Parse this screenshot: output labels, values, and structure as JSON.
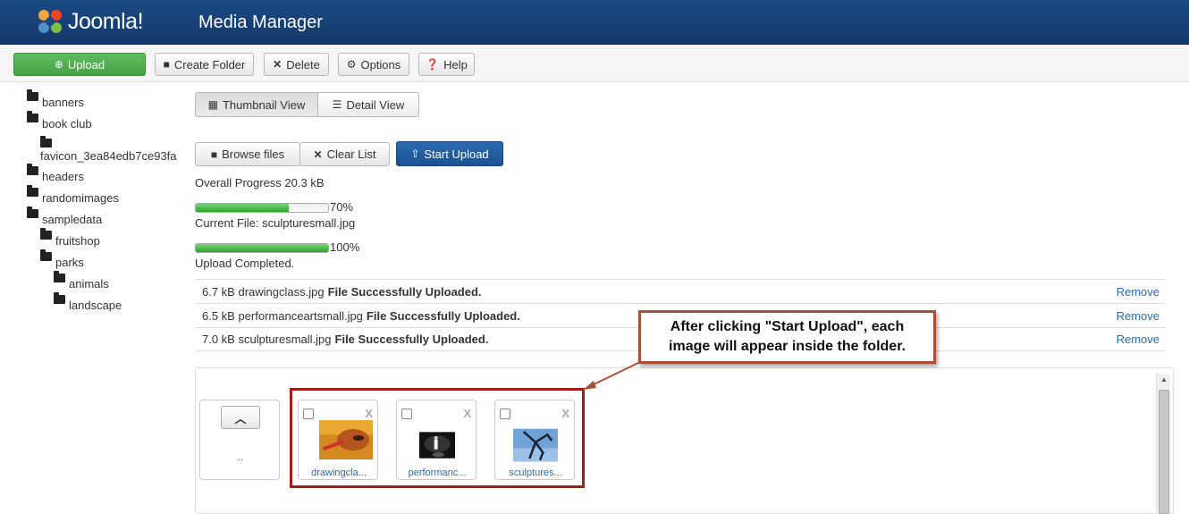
{
  "header": {
    "logo_text": "Joomla!",
    "title": "Media Manager",
    "brand_color": "#14396a"
  },
  "toolbar": {
    "upload": "Upload",
    "create_folder": "Create Folder",
    "delete": "Delete",
    "options": "Options",
    "help": "Help"
  },
  "tree": [
    {
      "label": "banners",
      "depth": 0
    },
    {
      "label": "book club",
      "depth": 0
    },
    {
      "label": "favicon_3ea84edb7ce93fa",
      "depth": 1
    },
    {
      "label": "headers",
      "depth": 0
    },
    {
      "label": "randomimages",
      "depth": 0
    },
    {
      "label": "sampledata",
      "depth": 0
    },
    {
      "label": "fruitshop",
      "depth": 1
    },
    {
      "label": "parks",
      "depth": 1
    },
    {
      "label": "animals",
      "depth": 2
    },
    {
      "label": "landscape",
      "depth": 2
    }
  ],
  "view_tabs": {
    "thumbnail": "Thumbnail View",
    "detail": "Detail View",
    "active": "thumbnail"
  },
  "uploader": {
    "browse": "Browse files",
    "clear": "Clear List",
    "start": "Start Upload",
    "overall": "Overall Progress 20.3 kB",
    "file_progress": 0.7,
    "file_percent": "70%",
    "current_file": "Current File: sculpturesmall.jpg",
    "total_progress": 1.0,
    "total_percent": "100%",
    "completed": "Upload Completed."
  },
  "uploaded": [
    {
      "info": "6.7 kB drawingclass.jpg",
      "status": "File Successfully Uploaded.",
      "action": "Remove"
    },
    {
      "info": "6.5 kB performanceartsmall.jpg",
      "status": "File Successfully Uploaded.",
      "action": "Remove"
    },
    {
      "info": "7.0 kB sculpturesmall.jpg",
      "status": "File Successfully Uploaded.",
      "action": "Remove"
    }
  ],
  "media": {
    "up_label": "..",
    "thumbs": [
      {
        "caption": "drawingcla...",
        "close": "X"
      },
      {
        "caption": "performanc...",
        "close": "X"
      },
      {
        "caption": "sculptures...",
        "close": "X"
      }
    ]
  },
  "callout": {
    "text": "After clicking \"Start Upload\", each image will appear inside the folder."
  }
}
